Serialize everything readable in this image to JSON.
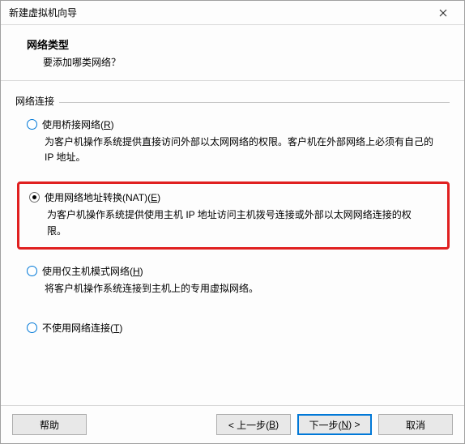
{
  "window": {
    "title": "新建虚拟机向导"
  },
  "header": {
    "title": "网络类型",
    "subtitle": "要添加哪类网络？"
  },
  "group": {
    "label": "网络连接"
  },
  "options": {
    "bridge": {
      "label_pre": "使用桥接网络(",
      "hotkey": "R",
      "label_post": ")",
      "desc": "为客户机操作系统提供直接访问外部以太网网络的权限。客户机在外部网络上必须有自己的 IP 地址。"
    },
    "nat": {
      "label_pre": "使用网络地址转换(NAT)(",
      "hotkey": "E",
      "label_post": ")",
      "desc": "为客户机操作系统提供使用主机 IP 地址访问主机拨号连接或外部以太网网络连接的权限。"
    },
    "hostonly": {
      "label_pre": "使用仅主机模式网络(",
      "hotkey": "H",
      "label_post": ")",
      "desc": "将客户机操作系统连接到主机上的专用虚拟网络。"
    },
    "none": {
      "label_pre": "不使用网络连接(",
      "hotkey": "T",
      "label_post": ")"
    }
  },
  "buttons": {
    "help": "帮助",
    "back_pre": "< 上一步(",
    "back_hot": "B",
    "back_post": ")",
    "next_pre": "下一步(",
    "next_hot": "N",
    "next_post": ") >",
    "cancel": "取消"
  }
}
